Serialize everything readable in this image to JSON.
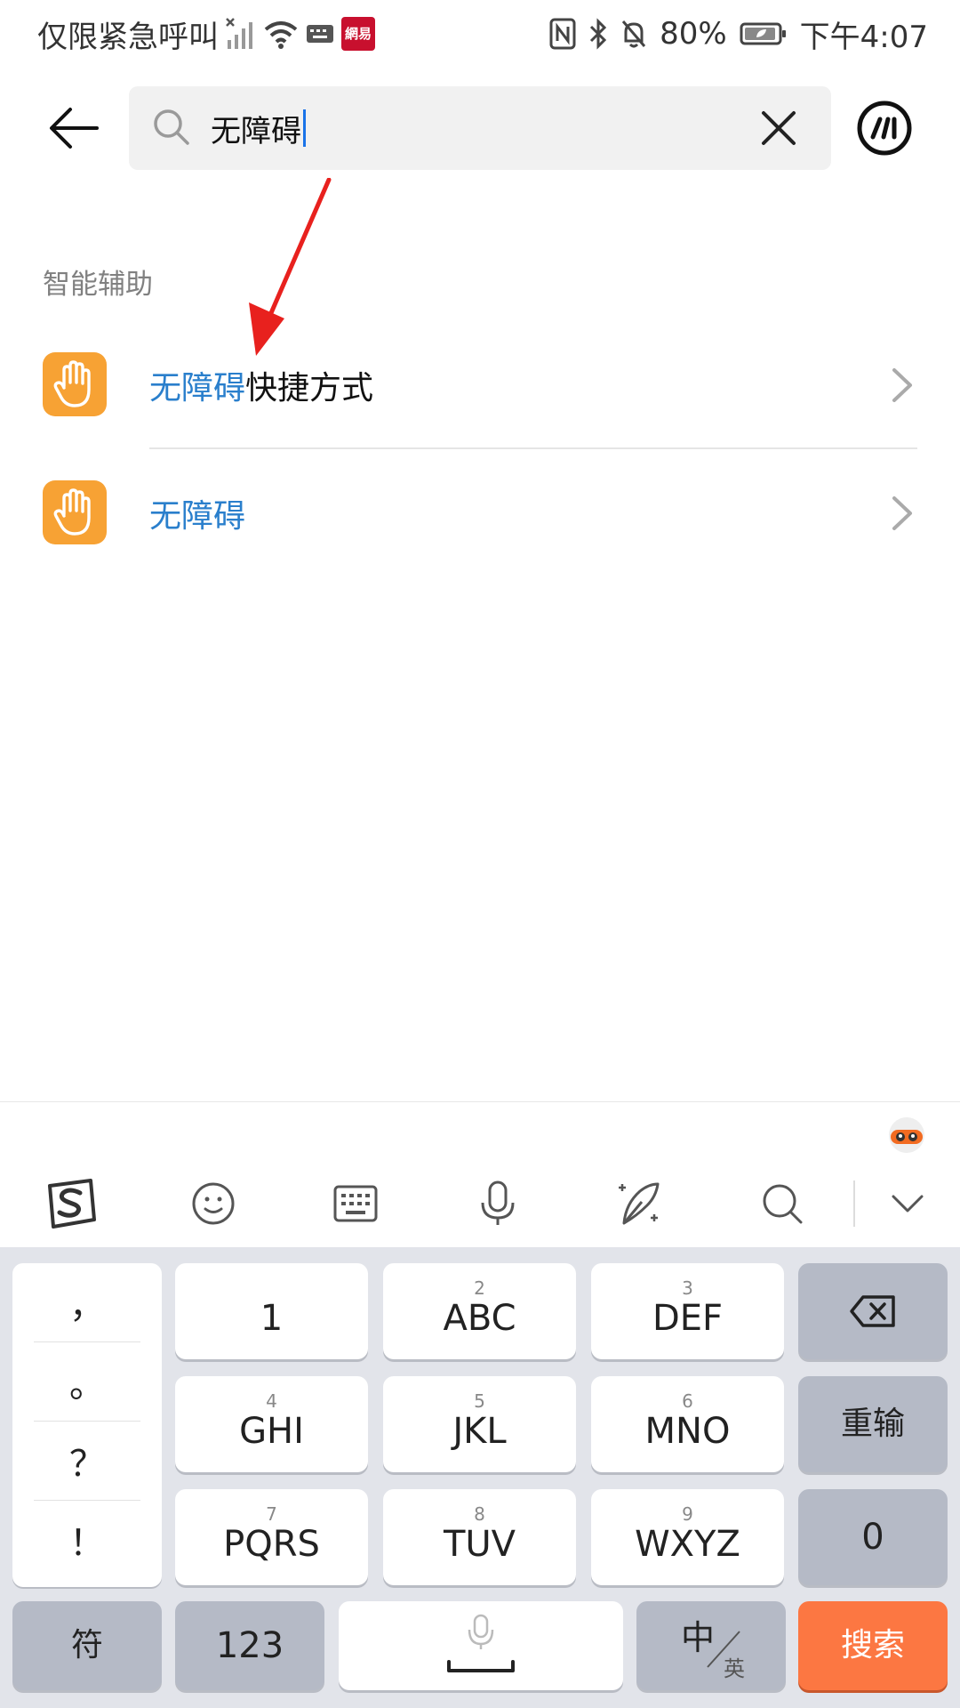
{
  "status_bar": {
    "carrier": "仅限紧急呼叫",
    "app_badge": "網易",
    "battery": "80%",
    "time": "下午4:07"
  },
  "search": {
    "query": "无障碍"
  },
  "section": {
    "title": "智能辅助"
  },
  "results": [
    {
      "highlight": "无障碍",
      "rest": "快捷方式"
    },
    {
      "highlight": "无障碍",
      "rest": ""
    }
  ],
  "keyboard": {
    "punctuation": [
      "，",
      "。",
      "？",
      "！"
    ],
    "keys": [
      {
        "num": "",
        "label": "1"
      },
      {
        "num": "2",
        "label": "ABC"
      },
      {
        "num": "3",
        "label": "DEF"
      },
      {
        "num": "4",
        "label": "GHI"
      },
      {
        "num": "5",
        "label": "JKL"
      },
      {
        "num": "6",
        "label": "MNO"
      },
      {
        "num": "7",
        "label": "PQRS"
      },
      {
        "num": "8",
        "label": "TUV"
      },
      {
        "num": "9",
        "label": "WXYZ"
      }
    ],
    "reenter_label": "重输",
    "zero_label": "0",
    "symbol_label": "符",
    "numeric_label": "123",
    "lang_primary": "中",
    "lang_secondary": "英",
    "search_label": "搜索"
  },
  "colors": {
    "highlight": "#2a7fcc",
    "app_icon": "#f7a234",
    "search_key": "#fc7742",
    "keyboard_bg": "#e2e4ea"
  }
}
